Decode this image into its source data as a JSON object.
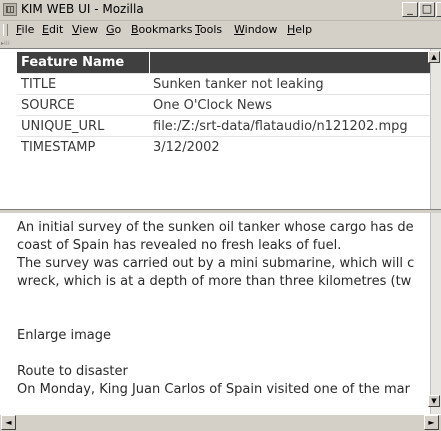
{
  "window": {
    "title": "KIM WEB UI - Mozilla",
    "buttons": {
      "minimize": "_",
      "maximize": "□",
      "close": "×"
    }
  },
  "menubar": {
    "items": [
      {
        "label": "File",
        "accel": "F",
        "rest": "ile"
      },
      {
        "label": "Edit",
        "accel": "E",
        "rest": "dit"
      },
      {
        "label": "View",
        "accel": "V",
        "rest": "iew"
      },
      {
        "label": "Go",
        "accel": "G",
        "rest": "o"
      },
      {
        "label": "Bookmarks",
        "accel": "B",
        "rest": "ookmarks"
      },
      {
        "label": "Tools",
        "accel": "T",
        "rest": "ools"
      },
      {
        "label": "Window",
        "accel": "W",
        "rest": "indow"
      },
      {
        "label": "Help",
        "accel": "H",
        "rest": "elp"
      }
    ]
  },
  "table": {
    "header_col1": "Feature Name",
    "header_col2": "",
    "rows": [
      {
        "name": "TITLE",
        "value": "Sunken tanker not leaking"
      },
      {
        "name": "SOURCE",
        "value": "One O'Clock News"
      },
      {
        "name": "UNIQUE_URL",
        "value": "file:/Z:/srt-data/flataudio/n121202.mpg"
      },
      {
        "name": "TIMESTAMP",
        "value": "3/12/2002"
      }
    ]
  },
  "article": {
    "lines": [
      "An initial survey of the sunken oil tanker whose cargo has de",
      "coast of Spain has revealed no fresh leaks of fuel.",
      "The survey was carried out by a mini submarine, which will c",
      "wreck, which is at a depth of more than three kilometres (tw",
      "",
      "",
      "Enlarge image",
      "",
      "Route to disaster",
      "On Monday, King Juan Carlos of Spain visited one of the mar"
    ]
  },
  "scrollbar": {
    "left_arrow": "◄",
    "right_arrow": "►",
    "up_arrow": "▲",
    "down_arrow": "▼"
  }
}
